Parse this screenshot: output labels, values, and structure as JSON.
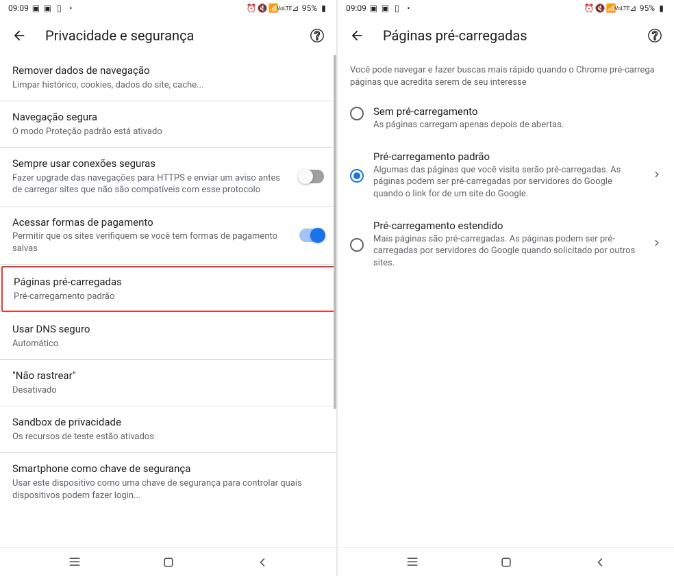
{
  "status_bar": {
    "time": "09:09",
    "battery_pct": "95%"
  },
  "screen1": {
    "app_title": "Privacidade e segurança",
    "items": [
      {
        "title": "Remover dados de navegação",
        "subtitle": "Limpar histórico, cookies, dados do site, cache..."
      },
      {
        "title": "Navegação segura",
        "subtitle": "O modo Proteção padrão está ativado"
      },
      {
        "title": "Sempre usar conexões seguras",
        "subtitle": "Fazer upgrade das navegações para HTTPS e enviar um aviso antes de carregar sites que não são compatíveis com esse protocolo"
      },
      {
        "title": "Acessar formas de pagamento",
        "subtitle": "Permitir que os sites verifiquem se você tem formas de pagamento salvas"
      },
      {
        "title": "Páginas pré-carregadas",
        "subtitle": "Pré-carregamento padrão"
      },
      {
        "title": "Usar DNS seguro",
        "subtitle": "Automático"
      },
      {
        "title": "\"Não rastrear\"",
        "subtitle": "Desativado"
      },
      {
        "title": "Sandbox de privacidade",
        "subtitle": "Os recursos de teste estão ativados"
      },
      {
        "title": "Smartphone como chave de segurança",
        "subtitle": "Usar este dispositivo como uma chave de segurança para controlar quais dispositivos podem fazer login..."
      }
    ]
  },
  "screen2": {
    "app_title": "Páginas pré-carregadas",
    "description": "Você pode navegar e fazer buscas mais rápido quando o Chrome pré-carrega páginas que acredita serem de seu interesse",
    "options": [
      {
        "title": "Sem pré-carregamento",
        "subtitle": "As páginas carregam apenas depois de abertas."
      },
      {
        "title": "Pré-carregamento padrão",
        "subtitle": "Algumas das páginas que você visita serão pré-carregadas. As páginas podem ser pré-carregadas por servidores do Google quando o link for de um site do Google."
      },
      {
        "title": "Pré-carregamento estendido",
        "subtitle": "Mais páginas são pré-carregadas. As páginas podem ser pré-carregadas por servidores do Google quando solicitado por outros sites."
      }
    ]
  }
}
